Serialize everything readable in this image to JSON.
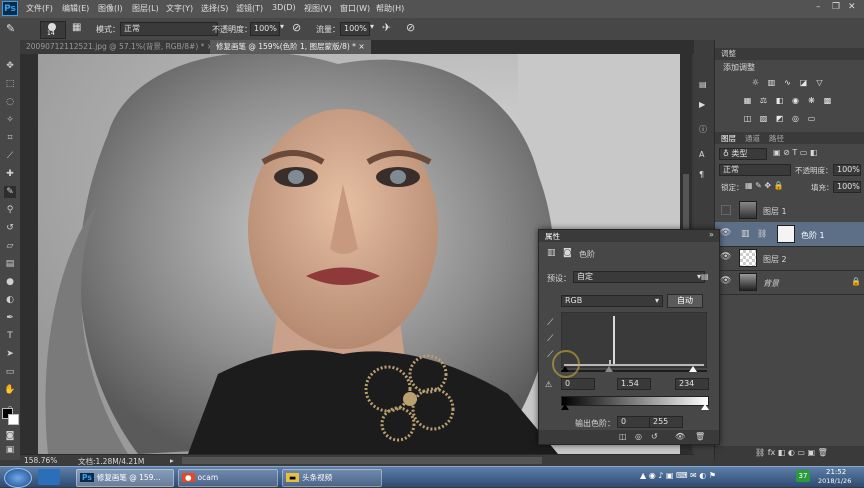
{
  "app": {
    "logo": "Ps"
  },
  "menu": [
    "文件(F)",
    "编辑(E)",
    "图像(I)",
    "图层(L)",
    "文字(Y)",
    "选择(S)",
    "滤镜(T)",
    "3D(D)",
    "视图(V)",
    "窗口(W)",
    "帮助(H)"
  ],
  "options": {
    "brush_size": "14",
    "mode_label": "模式：",
    "mode_value": "正常",
    "opacity_label": "不透明度：",
    "opacity_value": "100%",
    "flow_label": "流量：",
    "flow_value": "100%"
  },
  "tabs": [
    {
      "label": "20090712112521.jpg @ 57.1%(背景, RGB/8#) *",
      "active": false
    },
    {
      "label": "修复画笔 @ 159%(色阶 1, 图层蒙版/8) *",
      "active": true
    }
  ],
  "status": {
    "zoom": "158.76%",
    "doc": "文档:1.28M/4.21M"
  },
  "adjustments": {
    "tab": "调整",
    "title": "添加调整"
  },
  "layers_panel": {
    "tabs": [
      "图层",
      "通道",
      "路径"
    ],
    "filter_kind": "类型",
    "blend_mode": "正常",
    "opacity_label": "不透明度：",
    "opacity_value": "100%",
    "lock_label": "锁定：",
    "fill_label": "填充：",
    "fill_value": "100%",
    "layers": [
      {
        "name": "图层 1",
        "visible": false,
        "selected": false
      },
      {
        "name": "色阶 1",
        "visible": true,
        "selected": true
      },
      {
        "name": "图层 2",
        "visible": true,
        "selected": false
      },
      {
        "name": "背景",
        "visible": true,
        "selected": false
      }
    ]
  },
  "properties": {
    "title": "属性",
    "adjust_name": "色阶",
    "preset_label": "预设：",
    "preset_value": "自定",
    "channel": "RGB",
    "auto_button": "自动",
    "input_black": "0",
    "input_gamma": "1.54",
    "input_white": "234",
    "output_label": "输出色阶：",
    "output_black": "0",
    "output_white": "255"
  },
  "taskbar": {
    "apps": [
      "修复画笔 @ 159...",
      "ocam",
      "头条视频"
    ],
    "clock_time": "21:52",
    "clock_date": "2018/1/26"
  },
  "colors": {
    "panel_bg": "#474747",
    "menubar_bg": "#535353",
    "selected_layer": "#5d6f86",
    "accent": "#3ca0e8"
  }
}
